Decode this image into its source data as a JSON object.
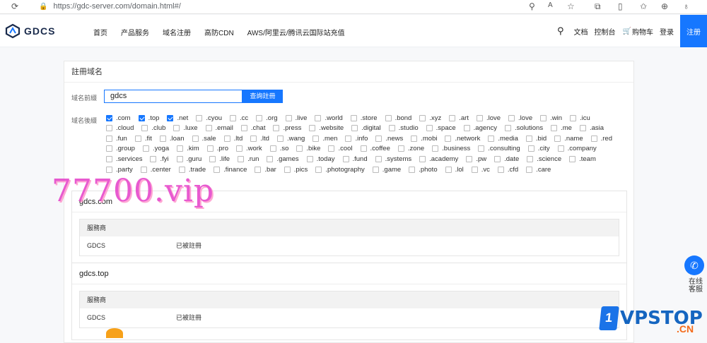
{
  "browser": {
    "url": "https://gdc-server.com/domain.html#/"
  },
  "header": {
    "logo": "GDCS",
    "nav": [
      "首页",
      "产品服务",
      "域名注册",
      "高防CDN",
      "AWS/阿里云/腾讯云国际站充值"
    ],
    "right": [
      "文档",
      "控制台",
      "购物车",
      "登录"
    ],
    "register": "注册"
  },
  "panel": {
    "title": "註冊域名",
    "prefix_label": "域名前綴",
    "prefix_value": "gdcs",
    "search_label": "查詢註冊",
    "suffix_label": "域名後綴",
    "tlds": [
      {
        "n": ".com",
        "c": true
      },
      {
        "n": ".top",
        "c": true
      },
      {
        "n": ".net",
        "c": true
      },
      {
        "n": ".cyou"
      },
      {
        "n": ".cc"
      },
      {
        "n": ".org"
      },
      {
        "n": ".live"
      },
      {
        "n": ".world"
      },
      {
        "n": ".store"
      },
      {
        "n": ".bond"
      },
      {
        "n": ".xyz"
      },
      {
        "n": ".art"
      },
      {
        "n": ".love"
      },
      {
        "n": ".love"
      },
      {
        "n": ".win"
      },
      {
        "n": ".icu"
      },
      {
        "n": ".cloud"
      },
      {
        "n": ".club"
      },
      {
        "n": ".luxe"
      },
      {
        "n": ".email"
      },
      {
        "n": ".chat"
      },
      {
        "n": ".press"
      },
      {
        "n": ".website"
      },
      {
        "n": ".digital"
      },
      {
        "n": ".studio"
      },
      {
        "n": ".space"
      },
      {
        "n": ".agency"
      },
      {
        "n": ".solutions"
      },
      {
        "n": ".me"
      },
      {
        "n": ".asia"
      },
      {
        "n": ".fun"
      },
      {
        "n": ".fit"
      },
      {
        "n": ".loan"
      },
      {
        "n": ".sale"
      },
      {
        "n": ".ltd"
      },
      {
        "n": ".ltd"
      },
      {
        "n": ".wang"
      },
      {
        "n": ".men"
      },
      {
        "n": ".info"
      },
      {
        "n": ".news"
      },
      {
        "n": ".mobi"
      },
      {
        "n": ".network"
      },
      {
        "n": ".media"
      },
      {
        "n": ".bid"
      },
      {
        "n": ".name"
      },
      {
        "n": ".red"
      },
      {
        "n": ".group"
      },
      {
        "n": ".yoga"
      },
      {
        "n": ".kim"
      },
      {
        "n": ".pro"
      },
      {
        "n": ".work"
      },
      {
        "n": ".so"
      },
      {
        "n": ".bike"
      },
      {
        "n": ".cool"
      },
      {
        "n": ".coffee"
      },
      {
        "n": ".zone"
      },
      {
        "n": ".business"
      },
      {
        "n": ".consulting"
      },
      {
        "n": ".city"
      },
      {
        "n": ".company"
      },
      {
        "n": ".services"
      },
      {
        "n": ".fyi"
      },
      {
        "n": ".guru"
      },
      {
        "n": ".life"
      },
      {
        "n": ".run"
      },
      {
        "n": ".games"
      },
      {
        "n": ".today"
      },
      {
        "n": ".fund"
      },
      {
        "n": ".systems"
      },
      {
        "n": ".academy"
      },
      {
        "n": ".pw"
      },
      {
        "n": ".date"
      },
      {
        "n": ".science"
      },
      {
        "n": ".team"
      },
      {
        "n": ".party"
      },
      {
        "n": ".center"
      },
      {
        "n": ".trade"
      },
      {
        "n": ".finance"
      },
      {
        "n": ".bar"
      },
      {
        "n": ".pics"
      },
      {
        "n": ".photography"
      },
      {
        "n": ".game"
      },
      {
        "n": ".photo"
      },
      {
        "n": ".lol"
      },
      {
        "n": ".vc"
      },
      {
        "n": ".cfd"
      },
      {
        "n": ".care"
      }
    ]
  },
  "results": [
    {
      "domain": "gdcs.com",
      "header": "服務商",
      "provider": "GDCS",
      "status": "已被註冊"
    },
    {
      "domain": "gdcs.top",
      "header": "服務商",
      "provider": "GDCS",
      "status": "已被註冊"
    }
  ],
  "watermark": "77700.vip",
  "float": {
    "service": "在线客服"
  },
  "badge": {
    "text": "VPSTOP",
    "sub": ".CN",
    "num": "1"
  },
  "colors": {
    "accent": "#1677ff"
  }
}
